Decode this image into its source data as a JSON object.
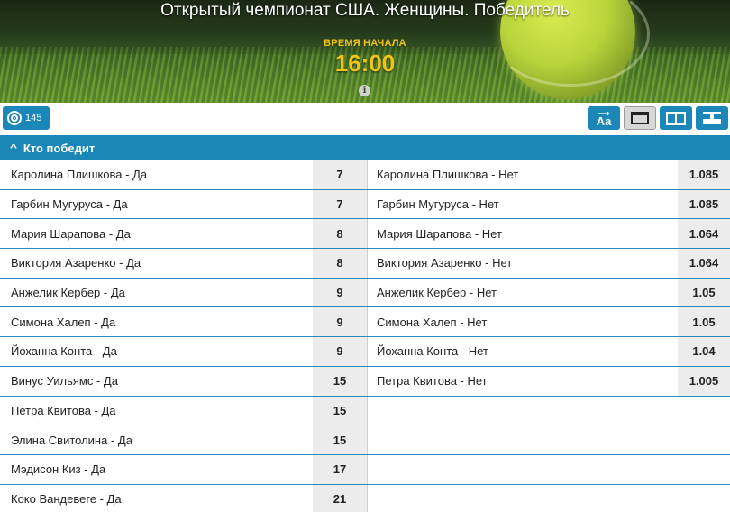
{
  "header": {
    "title": "Открытый чемпионат США. Женщины. Победитель",
    "start_label": "ВРЕМЯ НАЧАЛА",
    "start_time": "16:00",
    "info_icon": "info-icon"
  },
  "toolbar": {
    "count": "145",
    "count_icon": "target-icon",
    "font_button_label": "Aa",
    "view_buttons": [
      "font-size-icon",
      "single-column-icon",
      "two-column-icon",
      "collapse-icon"
    ]
  },
  "market": {
    "title": "Кто победит",
    "left": [
      {
        "name": "Каролина Плишкова - Да",
        "odd": "7"
      },
      {
        "name": "Гарбин Мугуруса - Да",
        "odd": "7"
      },
      {
        "name": "Мария Шарапова - Да",
        "odd": "8"
      },
      {
        "name": "Виктория Азаренко - Да",
        "odd": "8"
      },
      {
        "name": "Анжелик Кербер - Да",
        "odd": "9"
      },
      {
        "name": "Симона Халеп - Да",
        "odd": "9"
      },
      {
        "name": "Йоханна Конта - Да",
        "odd": "9"
      },
      {
        "name": "Винус Уильямс - Да",
        "odd": "15"
      },
      {
        "name": "Петра Квитова - Да",
        "odd": "15"
      },
      {
        "name": "Элина Свитолина - Да",
        "odd": "15"
      },
      {
        "name": "Мэдисон Киз - Да",
        "odd": "17"
      },
      {
        "name": "Коко Вандевеге - Да",
        "odd": "21"
      }
    ],
    "right": [
      {
        "name": "Каролина Плишкова - Нет",
        "odd": "1.085"
      },
      {
        "name": "Гарбин Мугуруса - Нет",
        "odd": "1.085"
      },
      {
        "name": "Мария Шарапова - Нет",
        "odd": "1.064"
      },
      {
        "name": "Виктория Азаренко - Нет",
        "odd": "1.064"
      },
      {
        "name": "Анжелик Кербер - Нет",
        "odd": "1.05"
      },
      {
        "name": "Симона Халеп - Нет",
        "odd": "1.05"
      },
      {
        "name": "Йоханна Конта - Нет",
        "odd": "1.04"
      },
      {
        "name": "Петра Квитова - Нет",
        "odd": "1.005"
      }
    ]
  },
  "colors": {
    "accent": "#1b86b8",
    "start_time": "#f2c318",
    "odd_cell": "#ececec"
  }
}
